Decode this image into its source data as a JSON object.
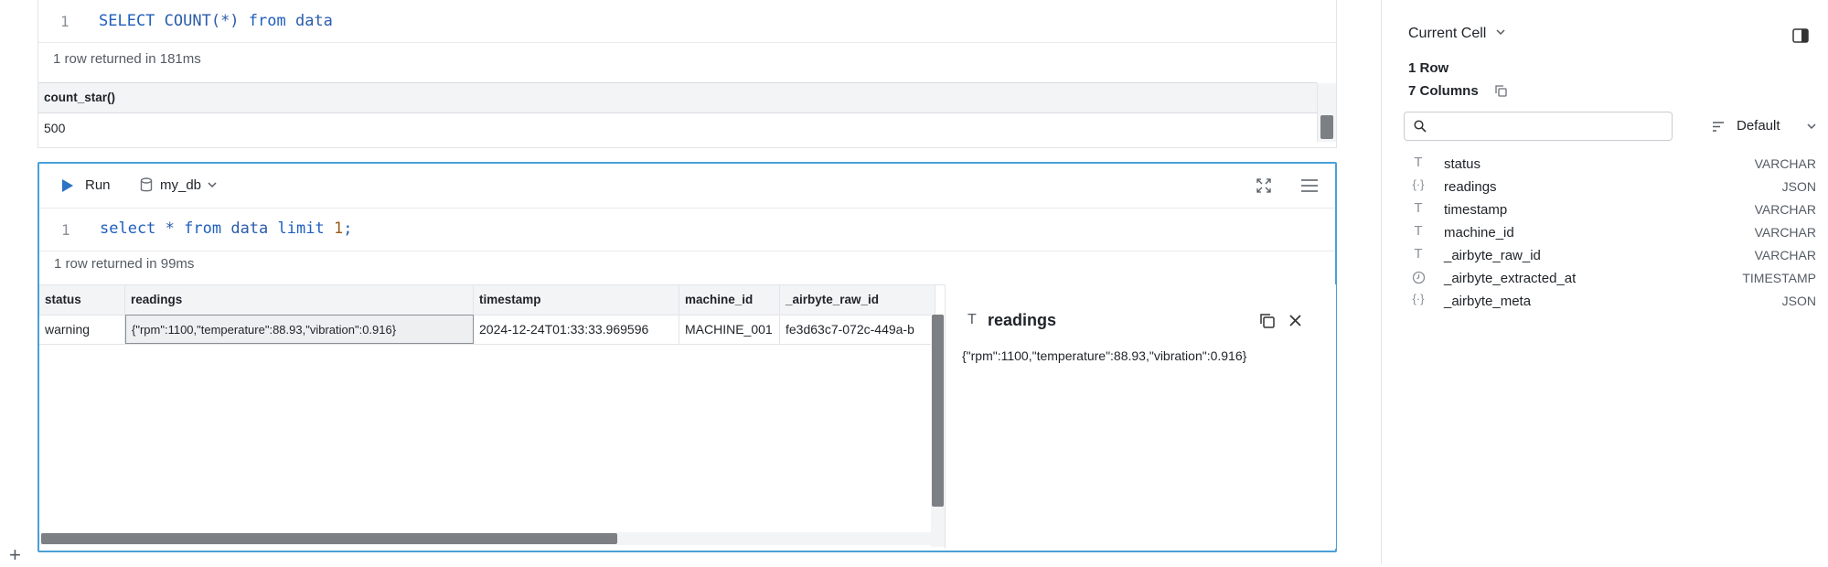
{
  "cell1": {
    "line_no": "1",
    "query_kw1": "SELECT",
    "query_fn": " COUNT(*) ",
    "query_kw2": "from",
    "query_rest": " data",
    "status": "1 row returned in 181ms",
    "columns": [
      "count_star()"
    ],
    "rows": [
      [
        "500"
      ]
    ]
  },
  "cell2": {
    "run_label": "Run",
    "db_label": "my_db",
    "line_no": "1",
    "query_kw1": "select",
    "query_mid": " * ",
    "query_kw2": "from",
    "query_rest": " data ",
    "query_kw3": "limit",
    "query_num": " 1",
    "query_end": ";",
    "status": "1 row returned in 99ms",
    "columns": [
      "status",
      "readings",
      "timestamp",
      "machine_id",
      "_airbyte_raw_id"
    ],
    "row": [
      "warning",
      "{\"rpm\":1100,\"temperature\":88.93,\"vibration\":0.916}",
      "2024-12-24T01:33:33.969596",
      "MACHINE_001",
      "fe3d63c7-072c-449a-b"
    ],
    "detail": {
      "title": "readings",
      "value": "{\"rpm\":1100,\"temperature\":88.93,\"vibration\":0.916}"
    }
  },
  "panel": {
    "header": "Current Cell",
    "rows": "1 Row",
    "columns_count": "7 Columns",
    "search_placeholder": "",
    "sort_label": "Default",
    "columns": [
      {
        "icon": "text-type-icon",
        "name": "status",
        "type": "VARCHAR"
      },
      {
        "icon": "json-type-icon",
        "name": "readings",
        "type": "JSON"
      },
      {
        "icon": "text-type-icon",
        "name": "timestamp",
        "type": "VARCHAR"
      },
      {
        "icon": "text-type-icon",
        "name": "machine_id",
        "type": "VARCHAR"
      },
      {
        "icon": "text-type-icon",
        "name": "_airbyte_raw_id",
        "type": "VARCHAR"
      },
      {
        "icon": "clock-type-icon",
        "name": "_airbyte_extracted_at",
        "type": "TIMESTAMP"
      },
      {
        "icon": "json-type-icon",
        "name": "_airbyte_meta",
        "type": "JSON"
      }
    ]
  },
  "add_cell_label": "+"
}
